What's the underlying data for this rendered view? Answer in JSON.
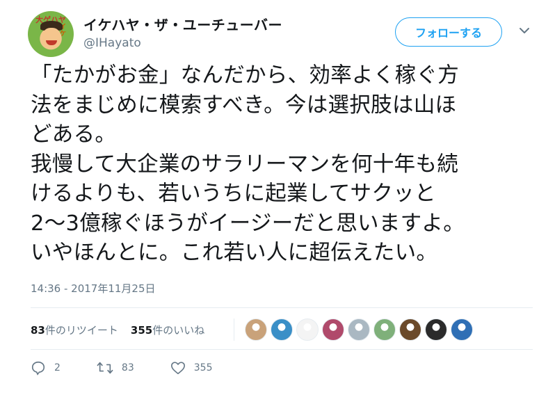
{
  "user": {
    "display_name": "イケハヤ・ザ・ユーチューバー",
    "handle": "@IHayato",
    "avatar_text_top": "大ゲハヤ",
    "avatar_text_side": "イケ"
  },
  "follow_button": {
    "label": "フォローする"
  },
  "tweet": {
    "text": "「たかがお金」なんだから、効率よく稼ぐ方\n法をまじめに模索すべき。今は選択肢は山ほ\nどある。\n我慢して大企業のサラリーマンを何十年も続\nけるよりも、若いうちに起業してサクッと\n2〜3億稼ぐほうがイージーだと思いますよ。\nいやほんとに。これ若い人に超伝えたい。",
    "timestamp": "14:36 - 2017年11月25日"
  },
  "stats": {
    "retweets_count": "83",
    "retweets_label": "件のリツイート",
    "likes_count": "355",
    "likes_label": "件のいいね"
  },
  "likers": [
    {
      "name": "liker-avatar-1",
      "color": "#c9a27a"
    },
    {
      "name": "liker-avatar-2",
      "color": "#3a8fc7"
    },
    {
      "name": "liker-avatar-3",
      "color": "#f4f4f4"
    },
    {
      "name": "liker-avatar-4",
      "color": "#b04a6b"
    },
    {
      "name": "liker-avatar-5",
      "color": "#aab8c2"
    },
    {
      "name": "liker-avatar-6",
      "color": "#7fb07a"
    },
    {
      "name": "liker-avatar-7",
      "color": "#6b4a2a"
    },
    {
      "name": "liker-avatar-8",
      "color": "#2b2b2b"
    },
    {
      "name": "liker-avatar-9",
      "color": "#2f6fb5"
    }
  ],
  "actions": {
    "reply_count": "2",
    "retweet_count": "83",
    "like_count": "355"
  },
  "colors": {
    "accent": "#1da1f2",
    "text": "#14171a",
    "secondary_text": "#657786",
    "divider": "#e6ecf0"
  }
}
